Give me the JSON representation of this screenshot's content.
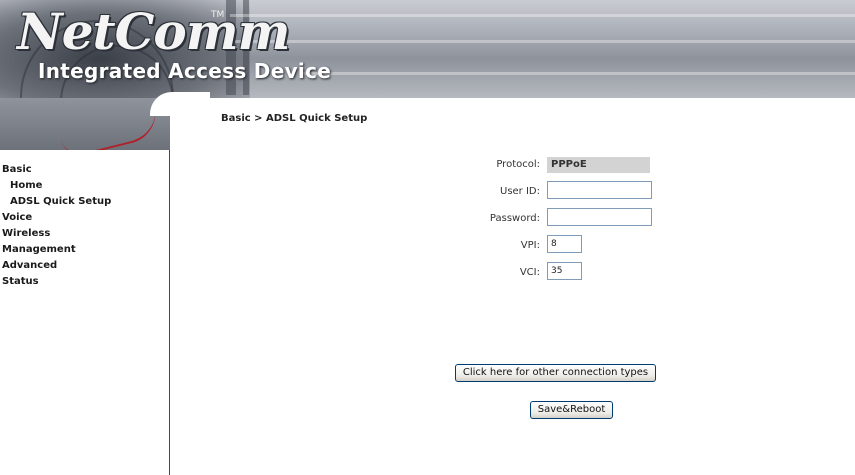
{
  "brand": {
    "logo": "NetComm",
    "trademark": "TM",
    "tagline": "Integrated Access Device"
  },
  "sidebar": {
    "items": [
      {
        "label": "Basic",
        "level": "top"
      },
      {
        "label": "Home",
        "level": "sub"
      },
      {
        "label": "ADSL Quick Setup",
        "level": "sub"
      },
      {
        "label": "Voice",
        "level": "top"
      },
      {
        "label": "Wireless",
        "level": "top"
      },
      {
        "label": "Management",
        "level": "top"
      },
      {
        "label": "Advanced",
        "level": "top"
      },
      {
        "label": "Status",
        "level": "top"
      }
    ]
  },
  "breadcrumb": "Basic > ADSL Quick Setup",
  "form": {
    "protocol_label": "Protocol:",
    "protocol_value": "PPPoE",
    "userid_label": "User ID:",
    "userid_value": "",
    "password_label": "Password:",
    "password_value": "",
    "vpi_label": "VPI:",
    "vpi_value": "8",
    "vci_label": "VCI:",
    "vci_value": "35"
  },
  "buttons": {
    "other_connection": "Click here for other connection types",
    "save_reboot": "Save&Reboot"
  },
  "colors": {
    "sidebar_border": "#c8101a",
    "input_border": "#7f9db9"
  }
}
